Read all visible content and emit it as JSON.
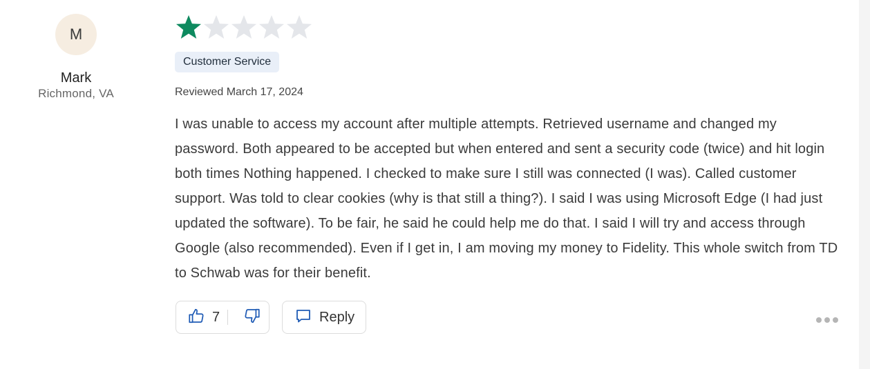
{
  "author": {
    "initial": "M",
    "name": "Mark",
    "location": "Richmond, VA"
  },
  "review": {
    "rating": 1,
    "max_rating": 5,
    "star_color": "#0e8a5f",
    "empty_star_color": "#e4e6ea",
    "tag": "Customer Service",
    "date": "Reviewed March 17, 2024",
    "text": "I was unable to access my account after multiple attempts. Retrieved username and changed my password. Both appeared to be accepted but when entered and sent a security code (twice) and hit login both times Nothing happened. I checked to make sure I still was connected (I was). Called customer support. Was told to clear cookies (why is that still a thing?). I said I was using Microsoft Edge (I had just updated the software). To be fair, he said he could help me do that. I said I will try and access through Google (also recommended). Even if I get in, I am moving my money to Fidelity. This whole switch from TD to Schwab was for their benefit."
  },
  "actions": {
    "helpful_count": "7",
    "reply_label": "Reply",
    "icons": {
      "thumbs_up": "thumbs-up-icon",
      "thumbs_down": "thumbs-down-icon",
      "reply": "speech-bubble-icon",
      "more": "more-dots-icon"
    },
    "icon_color": "#1f5bb5"
  }
}
